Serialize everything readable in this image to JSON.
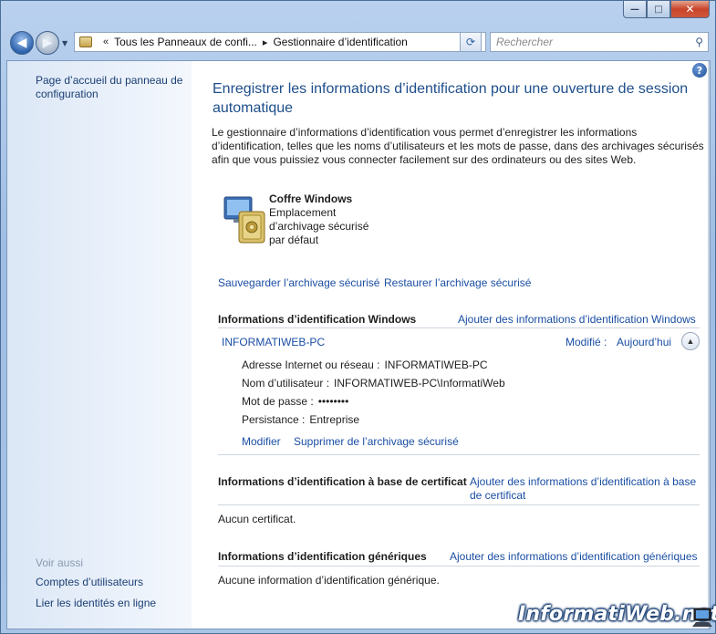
{
  "window": {
    "min_glyph": "—",
    "max_glyph": "□",
    "close_glyph": "✕"
  },
  "navbar": {
    "breadcrumb_sep": "«",
    "crumb1": "Tous les Panneaux de confi...",
    "crumb_arrow": "▸",
    "crumb2": "Gestionnaire d’identification",
    "search_placeholder": "Rechercher"
  },
  "sidebar": {
    "home_link": "Page d’accueil du panneau de configuration",
    "see_also": "Voir aussi",
    "links": [
      "Comptes d’utilisateurs",
      "Lier les identités en ligne"
    ]
  },
  "main": {
    "help": "?",
    "title": "Enregistrer les informations d’identification pour une ouverture de session automatique",
    "intro": "Le gestionnaire d’informations d’identification vous permet d’enregistrer les informations d’identification, telles que les noms d’utilisateurs et les mots de passe, dans des archivages sécurisés afin que vous puissiez vous connecter facilement sur des ordinateurs ou des sites Web.",
    "vault": {
      "title": "Coffre Windows",
      "description": "Emplacement d’archivage sécurisé par défaut"
    },
    "backup_link": "Sauvegarder l’archivage sécurisé",
    "restore_link": "Restaurer l’archivage sécurisé",
    "windows_creds": {
      "heading": "Informations d’identification Windows",
      "add_link": "Ajouter des informations d’identification Windows",
      "entry": {
        "name": "INFORMATIWEB-PC",
        "modified_label": "Modifié :",
        "modified_value": "Aujourd’hui",
        "address_label": "Adresse Internet ou réseau :",
        "address_value": "INFORMATIWEB-PC",
        "user_label": "Nom d’utilisateur :",
        "user_value": "INFORMATIWEB-PC\\InformatiWeb",
        "password_label": "Mot de passe :",
        "password_value": "••••••••",
        "persistence_label": "Persistance :",
        "persistence_value": "Entreprise",
        "edit_link": "Modifier",
        "remove_link": "Supprimer de l’archivage sécurisé"
      }
    },
    "cert_creds": {
      "heading": "Informations d’identification à base de certificat",
      "add_link": "Ajouter des informations d’identification à base de certificat",
      "empty": "Aucun certificat."
    },
    "generic_creds": {
      "heading": "Informations d’identification génériques",
      "add_link": "Ajouter des informations d’identification génériques",
      "empty": "Aucune information d’identification générique."
    }
  },
  "watermark": "InformatiWeb.net",
  "colors": {
    "link": "#1a4ea3",
    "title": "#1e4e8c",
    "sidebar_bg": "#dbe7f6"
  }
}
